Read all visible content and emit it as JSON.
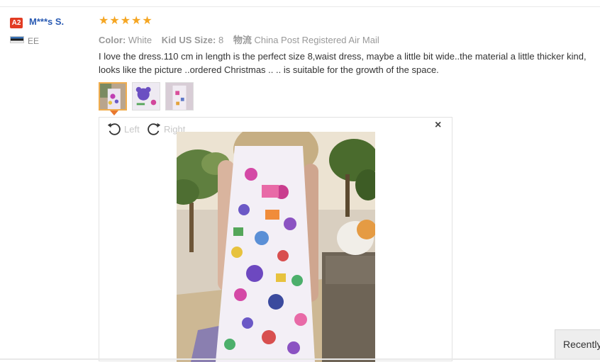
{
  "user": {
    "level_badge": "A2",
    "name": "M***s S.",
    "country": "EE"
  },
  "review": {
    "rating": 5,
    "color_label": "Color:",
    "color_value": "White",
    "size_label": "Kid US Size:",
    "size_value": "8",
    "shipping_label": "物流",
    "shipping_value": "China Post Registered Air Mail",
    "text_line1": "I love the dress.110 cm in length is the perfect size 8,waist dress, maybe a little bit wide..the material a little thicker kind,",
    "text_line2": "looks like the picture ..ordered Christmas .. .. is suitable for the growth of the space."
  },
  "viewer": {
    "rotate_left_label": "Left",
    "rotate_right_label": "Right",
    "close_symbol": "×"
  },
  "recently_label": "Recently",
  "colors": {
    "accent_orange": "#e9782e",
    "star": "#f5a623",
    "user_link": "#2a5bb3",
    "badge": "#e23c23"
  },
  "icons": [
    "star-icon",
    "flag-icon",
    "rotate-left-icon",
    "rotate-right-icon",
    "close-icon"
  ]
}
